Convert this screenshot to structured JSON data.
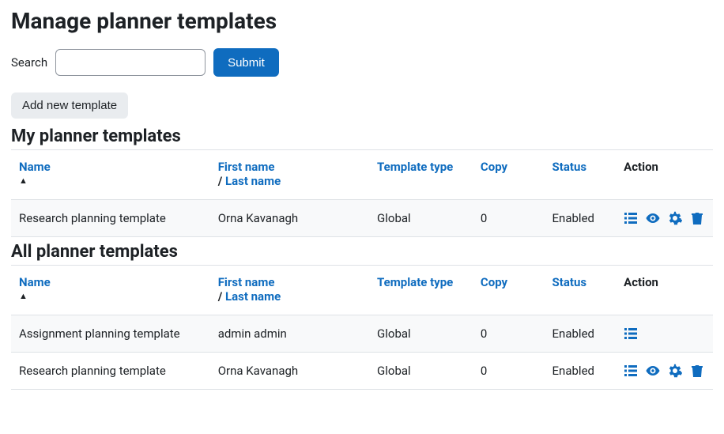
{
  "page": {
    "title": "Manage planner templates"
  },
  "search": {
    "label": "Search",
    "value": "",
    "submit": "Submit"
  },
  "buttons": {
    "add_template": "Add new template"
  },
  "sections": {
    "my": {
      "title": "My planner templates",
      "headers": {
        "name": "Name",
        "first_name": "First name",
        "last_name": "Last name",
        "sep": "/",
        "template_type": "Template type",
        "copy": "Copy",
        "status": "Status",
        "action": "Action"
      },
      "rows": [
        {
          "name": "Research planning template",
          "owner": "Orna Kavanagh",
          "type": "Global",
          "copy": "0",
          "status": "Enabled",
          "actions": [
            "list",
            "eye",
            "gear",
            "trash"
          ]
        }
      ]
    },
    "all": {
      "title": "All planner templates",
      "headers": {
        "name": "Name",
        "first_name": "First name",
        "last_name": "Last name",
        "sep": "/",
        "template_type": "Template type",
        "copy": "Copy",
        "status": "Status",
        "action": "Action"
      },
      "rows": [
        {
          "name": "Assignment planning template",
          "owner": "admin admin",
          "type": "Global",
          "copy": "0",
          "status": "Enabled",
          "actions": [
            "list"
          ]
        },
        {
          "name": "Research planning template",
          "owner": "Orna Kavanagh",
          "type": "Global",
          "copy": "0",
          "status": "Enabled",
          "actions": [
            "list",
            "eye",
            "gear",
            "trash"
          ]
        }
      ]
    }
  }
}
